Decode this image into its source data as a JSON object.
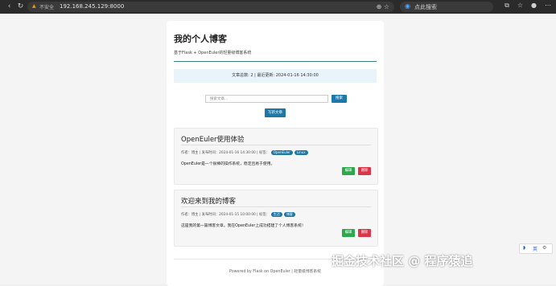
{
  "browser": {
    "url_warning_icon": "warning-icon",
    "insecure_label": "不安全",
    "url": "192.168.245.129:8000",
    "search_placeholder": "点此搜索"
  },
  "site": {
    "title": "我的个人博客",
    "subtitle": "基于Flask + OpenEuler的轻量级博客系统"
  },
  "stats": {
    "text": "文章总数: 2 | 最近更新: 2024-01-16 14:30:00"
  },
  "search": {
    "placeholder": "搜索文章...",
    "button_label": "搜索"
  },
  "new_post": {
    "label": "写新文章"
  },
  "posts": [
    {
      "title": "OpenEuler使用体验",
      "meta": "作者：博主 | 发布时间：2024-01-16 14:30:00 | 标签：",
      "tags": [
        "OpenEuler",
        "Linux"
      ],
      "excerpt": "OpenEuler是一个很棒的操作系统，稳定且易于使用。",
      "edit_label": "编辑",
      "delete_label": "删除"
    },
    {
      "title": "欢迎来到我的博客",
      "meta": "作者：博主 | 发布时间：2024-01-15 10:00:00 | 标签：",
      "tags": [
        "生活",
        "博客"
      ],
      "excerpt": "这是我的第一篇博客文章。我在OpenEuler上成功搭建了个人博客系统！",
      "edit_label": "编辑",
      "delete_label": "删除"
    }
  ],
  "footer": {
    "text": "Powered by Flask on OpenEuler | 轻量级博客系统"
  },
  "ime": {
    "label": "英"
  },
  "watermark": {
    "text": "掘金技术社区 @ 程序猿追"
  },
  "colors": {
    "primary": "#1b78a8",
    "success": "#2ea84c",
    "danger": "#d9364a"
  }
}
